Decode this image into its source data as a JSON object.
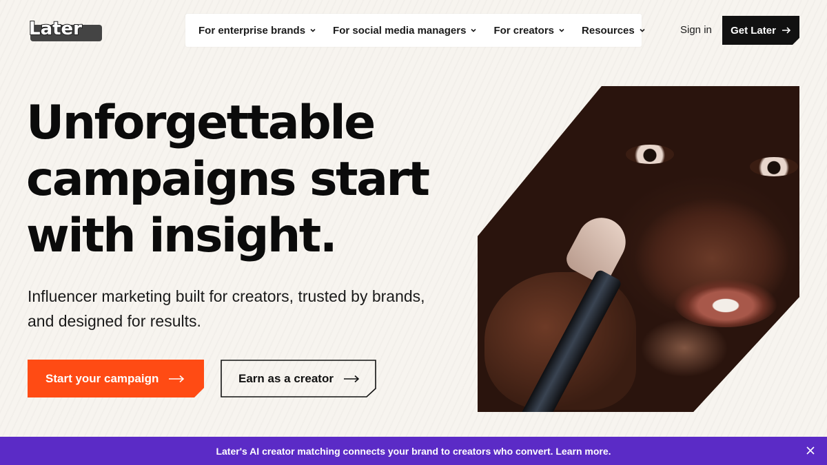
{
  "brand": {
    "logo_text": "Later"
  },
  "nav": {
    "items": [
      {
        "label": "For enterprise brands"
      },
      {
        "label": "For social media managers"
      },
      {
        "label": "For creators"
      },
      {
        "label": "Resources"
      }
    ],
    "sign_in": "Sign in",
    "cta": "Get Later"
  },
  "hero": {
    "headline_lines": [
      "Unforgettable",
      "campaigns start",
      "with insight."
    ],
    "subhead": "Influencer marketing built for creators, trusted by brands, and designed for results.",
    "primary_button": "Start your campaign",
    "secondary_button": "Earn as a creator"
  },
  "banner": {
    "text": "Later's AI creator matching connects your brand to creators who convert. Learn more."
  },
  "colors": {
    "background": "#f7f4ef",
    "primary_orange": "#ff4b14",
    "banner_purple": "#5b2bc6",
    "dark": "#111111"
  },
  "icons": [
    "chevron-down-icon",
    "arrow-right-icon",
    "close-icon"
  ]
}
